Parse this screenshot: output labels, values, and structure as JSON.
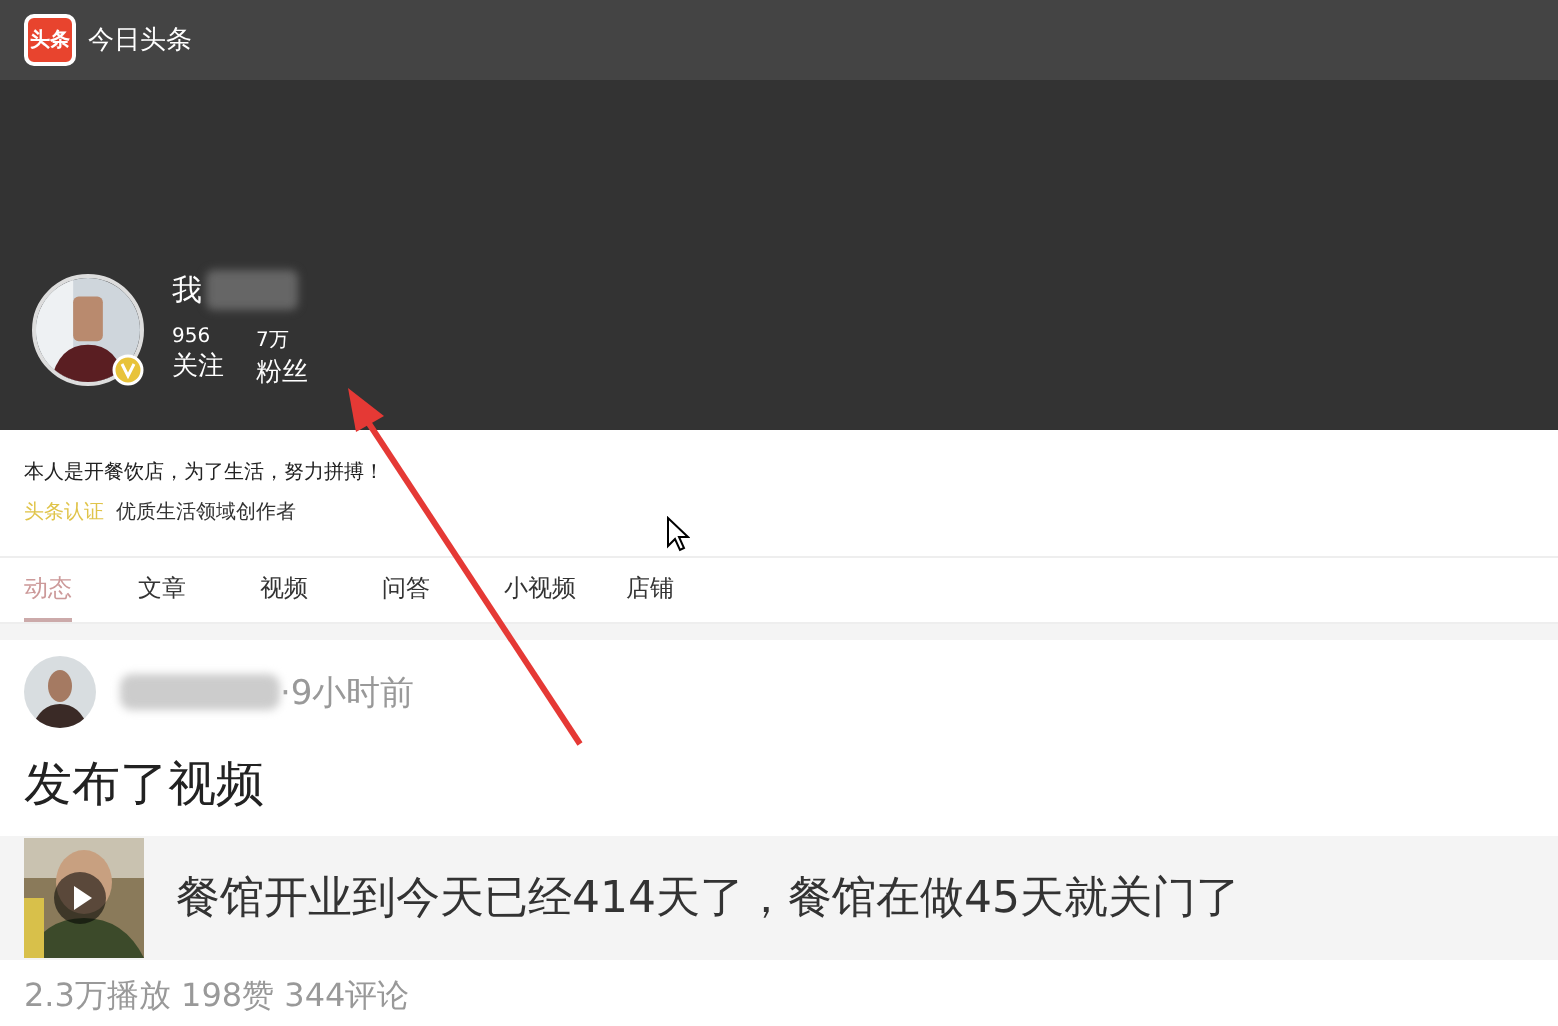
{
  "app_bar": {
    "logo": "头条",
    "title": "今日头条"
  },
  "profile": {
    "name": "我",
    "stats": [
      {
        "value": "956",
        "label": "关注"
      },
      {
        "value": "7万",
        "label": "粉丝"
      }
    ],
    "bio": "本人是开餐饮店，为了生活，努力拼搏！",
    "certification": {
      "badge": "头条认证",
      "text": "优质生活领域创作者"
    }
  },
  "tabs": [
    {
      "label": "动态",
      "selected": true
    },
    {
      "label": "文章",
      "selected": false
    },
    {
      "label": "视频",
      "selected": false
    },
    {
      "label": "问答",
      "selected": false
    },
    {
      "label": "小视频",
      "selected": false
    },
    {
      "label": "店铺",
      "selected": false
    }
  ],
  "post": {
    "time": "·9小时前",
    "action": "发布了视频",
    "video": {
      "title": "餐馆开业到今天已经414天了，餐馆在做45天就关门了"
    },
    "stats": "2.3万播放 198赞 344评论"
  }
}
